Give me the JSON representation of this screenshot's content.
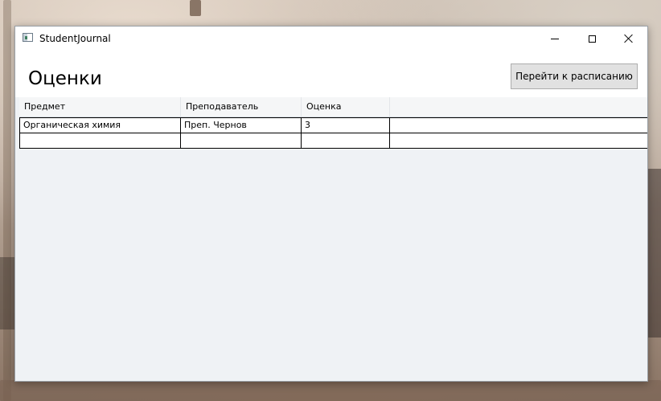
{
  "window": {
    "title": "StudentJournal"
  },
  "page": {
    "title": "Оценки",
    "nav_button_label": "Перейти к расписанию"
  },
  "grid": {
    "columns": [
      "Предмет",
      "Преподаватель",
      "Оценка",
      ""
    ],
    "rows": [
      [
        "Органическая химия",
        "Преп. Чернов",
        "3",
        ""
      ],
      [
        "",
        "",
        "",
        ""
      ]
    ]
  },
  "colors": {
    "window_background": "#eff2f5",
    "button_background": "#e1e1e1",
    "grid_lines": "#000000"
  },
  "icons": {
    "app": "app-window-icon",
    "minimize": "minimize-icon",
    "maximize": "maximize-icon",
    "close": "close-icon"
  }
}
